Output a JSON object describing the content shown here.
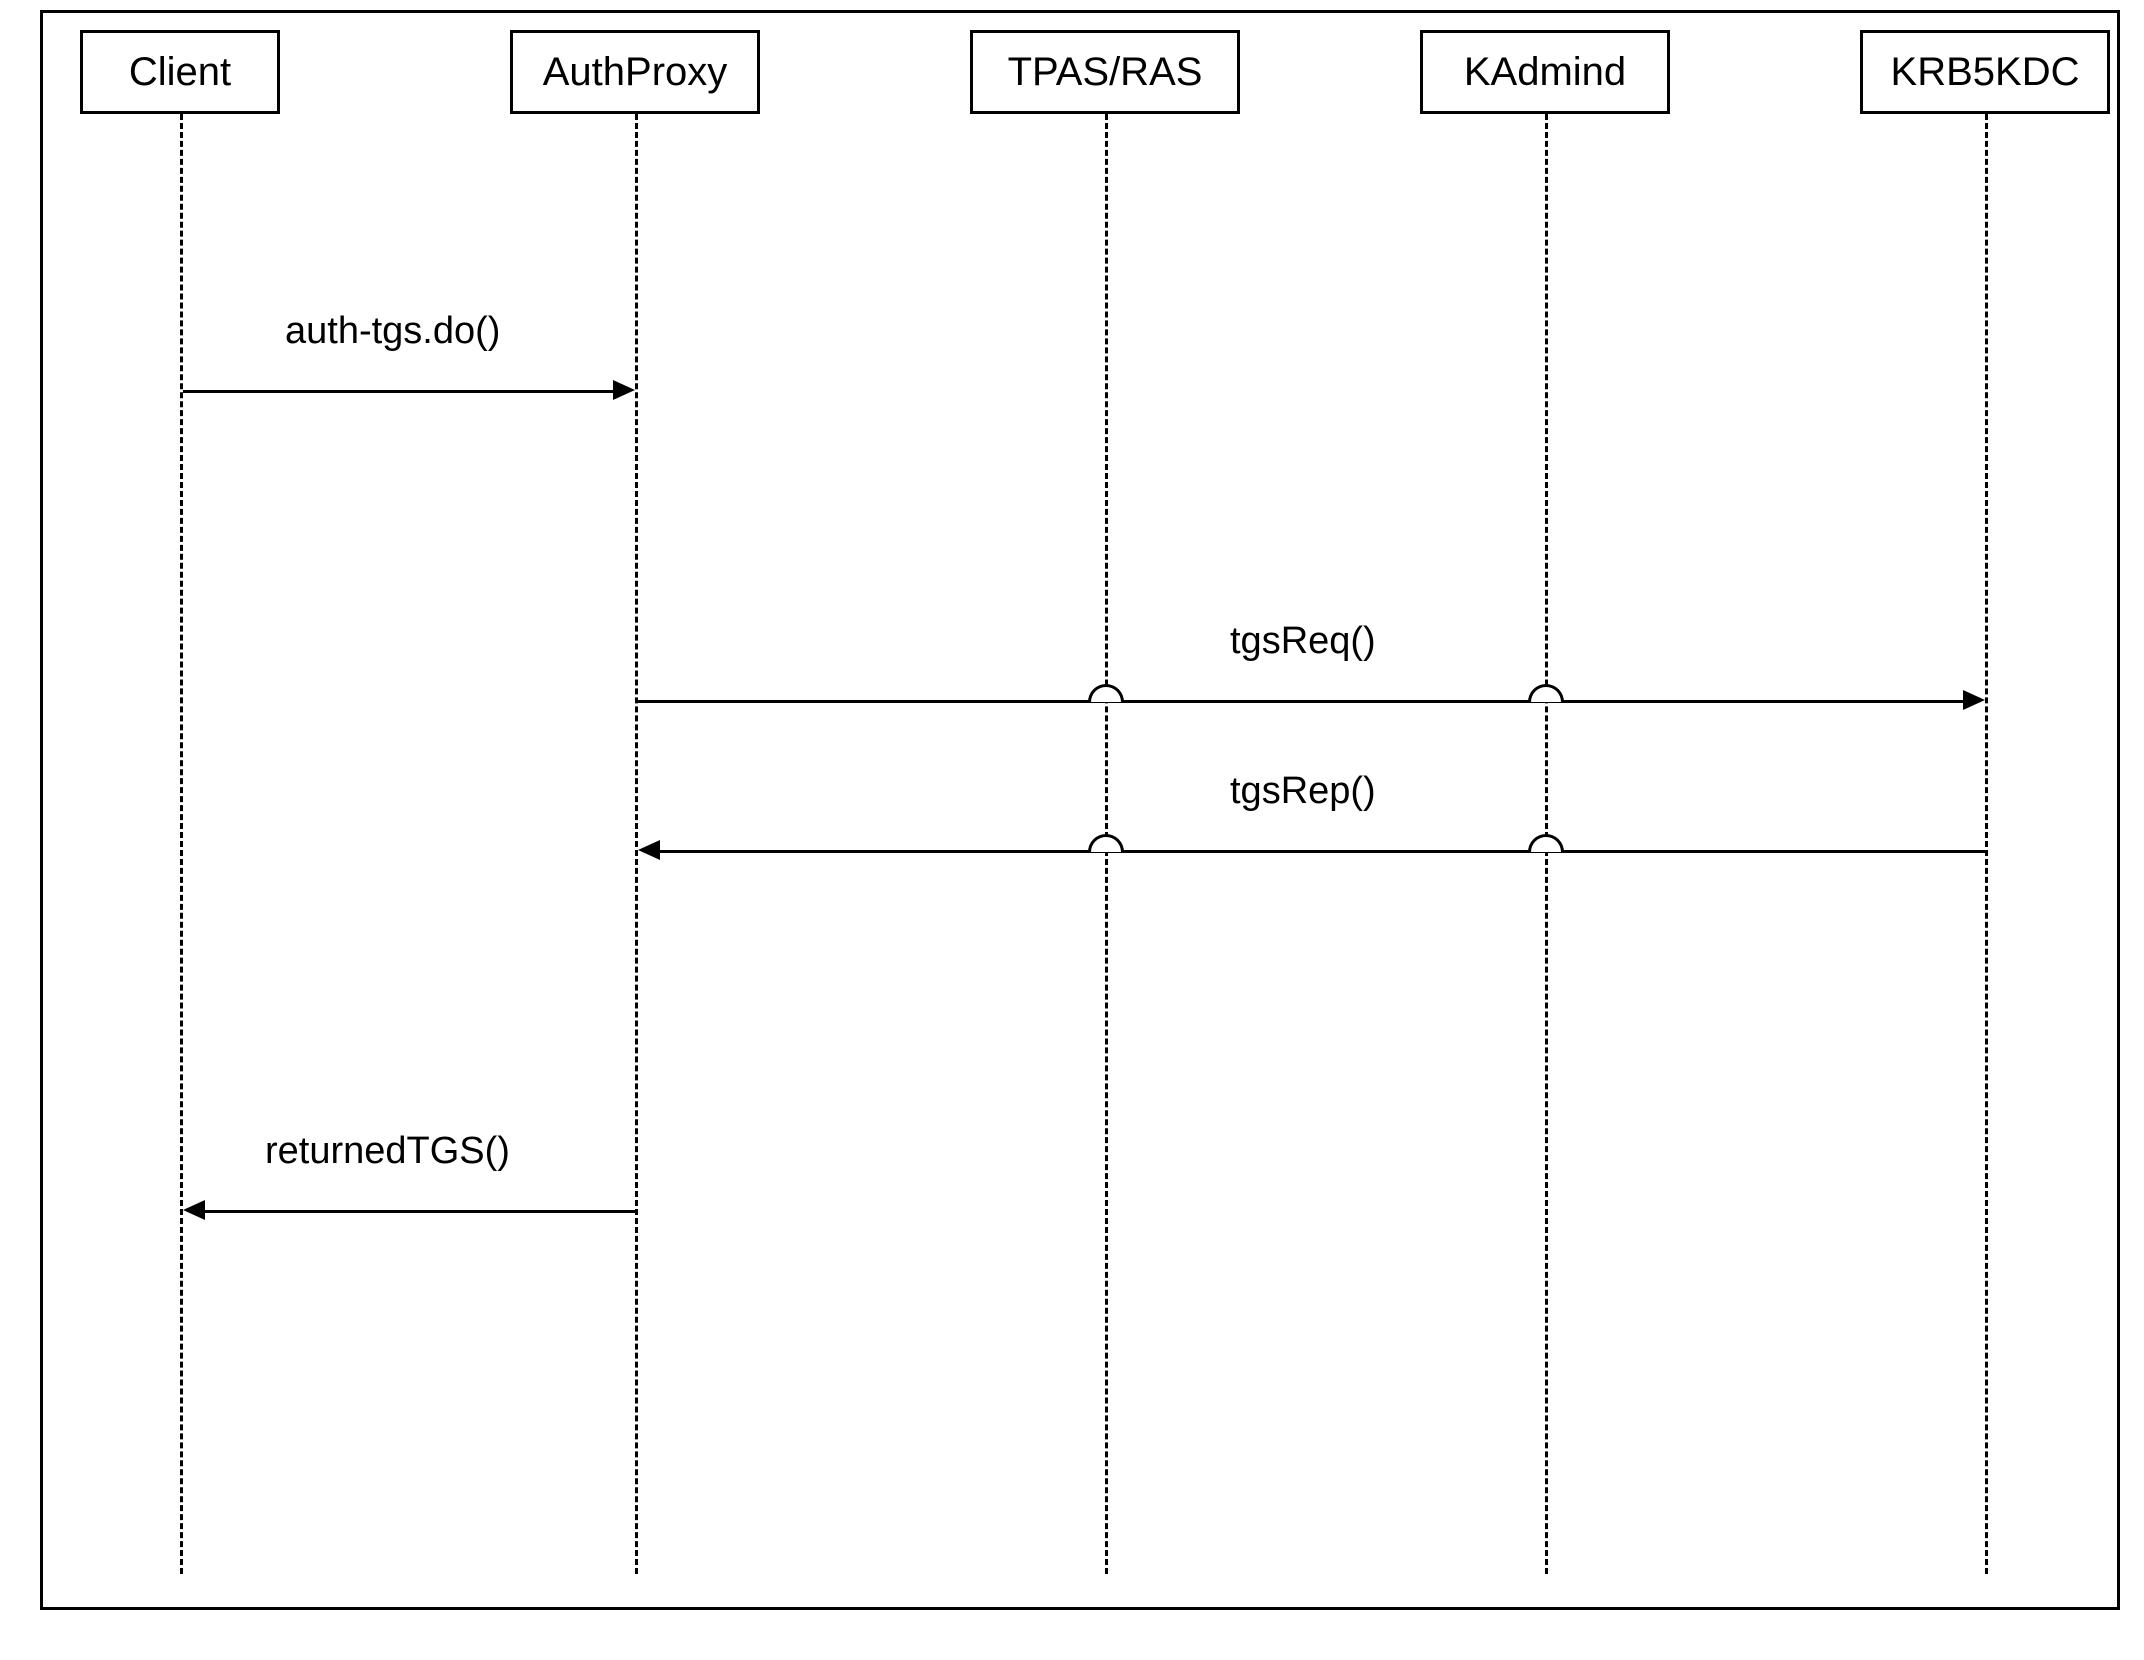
{
  "diagram": {
    "type": "sequence",
    "participants": [
      {
        "id": "client",
        "label": "Client"
      },
      {
        "id": "authproxy",
        "label": "AuthProxy"
      },
      {
        "id": "tpasras",
        "label": "TPAS/RAS"
      },
      {
        "id": "kadmind",
        "label": "KAdmind"
      },
      {
        "id": "krb5kdc",
        "label": "KRB5KDC"
      }
    ],
    "messages": [
      {
        "id": "m1",
        "from": "client",
        "to": "authproxy",
        "label": "auth-tgs.do()"
      },
      {
        "id": "m2",
        "from": "authproxy",
        "to": "krb5kdc",
        "label": "tgsReq()"
      },
      {
        "id": "m3",
        "from": "krb5kdc",
        "to": "authproxy",
        "label": "tgsRep()"
      },
      {
        "id": "m4",
        "from": "authproxy",
        "to": "client",
        "label": "returnedTGS()"
      }
    ]
  }
}
